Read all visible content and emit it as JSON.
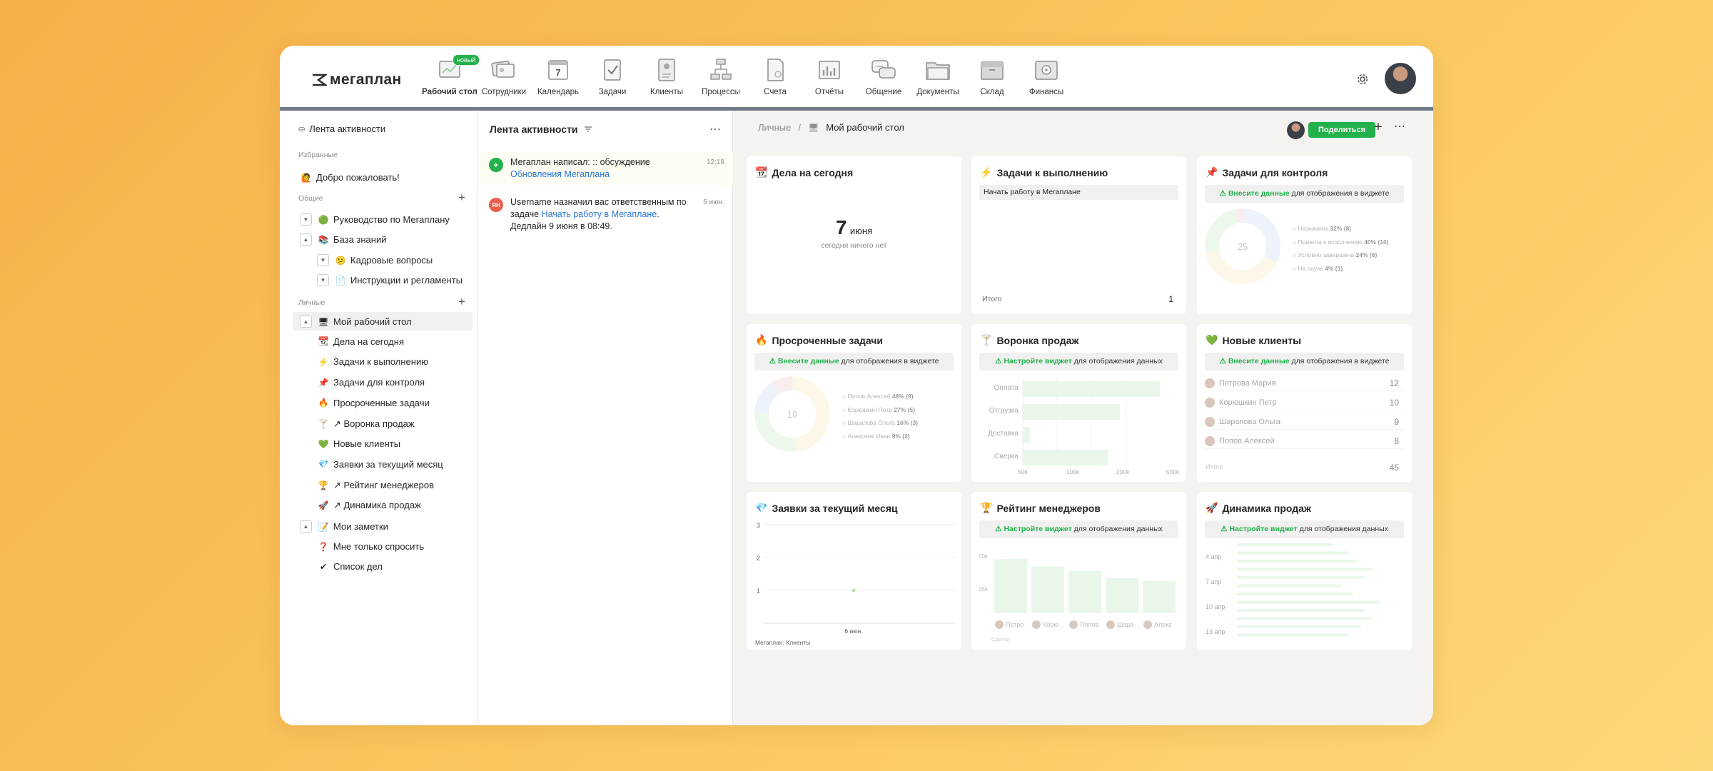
{
  "app": {
    "logo_text": "мегаплан"
  },
  "nav": [
    {
      "label": "Рабочий стол",
      "icon": "desktop-icon",
      "badge": "новый",
      "active": true
    },
    {
      "label": "Сотрудники",
      "icon": "employees-icon"
    },
    {
      "label": "Календарь",
      "icon": "calendar-icon",
      "day": "7"
    },
    {
      "label": "Задачи",
      "icon": "tasks-icon"
    },
    {
      "label": "Клиенты",
      "icon": "clients-icon"
    },
    {
      "label": "Процессы",
      "icon": "processes-icon"
    },
    {
      "label": "Счета",
      "icon": "invoices-icon"
    },
    {
      "label": "Отчёты",
      "icon": "reports-icon"
    },
    {
      "label": "Общение",
      "icon": "chat-icon"
    },
    {
      "label": "Документы",
      "icon": "documents-icon"
    },
    {
      "label": "Склад",
      "icon": "warehouse-icon"
    },
    {
      "label": "Финансы",
      "icon": "finance-icon"
    }
  ],
  "sidebar": {
    "top_item": "Лента активности",
    "favorites_title": "Избранные",
    "favorites": [
      {
        "label": "Добро пожаловать!",
        "emoji": "🙋"
      }
    ],
    "common_title": "Общие",
    "common": [
      {
        "label": "Руководство по Мегаплану",
        "emoji": "🟢"
      },
      {
        "label": "База знаний",
        "emoji": "📚"
      },
      {
        "label": "Кадровые вопросы",
        "emoji": "😕"
      },
      {
        "label": "Инструкции и регламенты",
        "emoji": "📄"
      }
    ],
    "personal_title": "Личные",
    "personal": [
      {
        "label": "Мой рабочий стол",
        "emoji": "🖥"
      },
      {
        "label": "Дела на сегодня",
        "emoji": "📆"
      },
      {
        "label": "Задачи к выполнению",
        "emoji": "⚡"
      },
      {
        "label": "Задачи для контроля",
        "emoji": "📌"
      },
      {
        "label": "Просроченные задачи",
        "emoji": "🔥"
      },
      {
        "label": "↗ Воронка продаж",
        "emoji": "🍸"
      },
      {
        "label": "Новые клиенты",
        "emoji": "💚"
      },
      {
        "label": "Заявки за текущий месяц",
        "emoji": "💎"
      },
      {
        "label": "↗ Рейтинг менеджеров",
        "emoji": "🏆"
      },
      {
        "label": "↗ Динамика продаж",
        "emoji": "🚀"
      },
      {
        "label": "Мои заметки",
        "emoji": "📝"
      },
      {
        "label": "Мне только спросить",
        "emoji": "❓"
      },
      {
        "label": "Список дел",
        "emoji": "✔"
      }
    ]
  },
  "feed": {
    "title": "Лента активности",
    "items": [
      {
        "prefix": "Мегаплан написал: :: обсуждение",
        "link": "Обновления Мегаплана",
        "suffix": "",
        "time": "12:18",
        "avatar": ""
      },
      {
        "prefix": "Username назначил вас ответственным по задаче ",
        "link": "Начать работу в Мегаплане",
        "suffix": ". Дедлайн 9 июня в 08:49.",
        "time": "6 июн.",
        "avatar": "ЯН"
      }
    ]
  },
  "main": {
    "breadcrumb_root": "Личные",
    "breadcrumb_current": "Мой рабочий стол",
    "share_label": "Поделиться"
  },
  "widgets": {
    "today": {
      "title": "Дела на сегодня",
      "emoji": "📆",
      "day": "7",
      "month": "июня",
      "note": "сегодня ничего нет"
    },
    "todo": {
      "title": "Задачи к выполнению",
      "emoji": "⚡",
      "task": "Начать работу в Мегаплане",
      "total_label": "Итого",
      "total": "1"
    },
    "control": {
      "title": "Задачи для контроля",
      "emoji": "📌",
      "warn_link": "⚠ Внесите данные",
      "warn_text": " для отображения в виджете",
      "center": "25",
      "legend": [
        {
          "label": "Назначена",
          "value": "32% (8)"
        },
        {
          "label": "Принята к исполнению",
          "value": "40% (10)"
        },
        {
          "label": "Условно завершена",
          "value": "24% (6)"
        },
        {
          "label": "На паузе",
          "value": "4% (1)"
        }
      ]
    },
    "overdue": {
      "title": "Просроченные задачи",
      "emoji": "🔥",
      "warn_link": "⚠ Внесите данные",
      "warn_text": " для отображения в виджете",
      "center": "19",
      "legend": [
        {
          "label": "Попов Алексей",
          "value": "48% (9)"
        },
        {
          "label": "Корюшкин Петр",
          "value": "27% (5)"
        },
        {
          "label": "Шарапова Ольга",
          "value": "16% (3)"
        },
        {
          "label": "Алексеев Иван",
          "value": "9% (2)"
        }
      ]
    },
    "funnel": {
      "title": "Воронка продаж",
      "emoji": "🍸",
      "warn_link": "⚠ Настройте виджет",
      "warn_text": " для отображения данных",
      "stages": [
        {
          "label": "Оплата",
          "value": 480
        },
        {
          "label": "Отгрузка",
          "value": 340
        },
        {
          "label": "Доставка",
          "value": 25
        },
        {
          "label": "Сверка",
          "value": 300
        }
      ],
      "ticks": [
        "50k",
        "100k",
        "200k",
        "500k"
      ]
    },
    "clients": {
      "title": "Новые клиенты",
      "emoji": "💚",
      "warn_link": "⚠ Внесите данные",
      "warn_text": " для отображения в виджете",
      "rows": [
        {
          "name": "Петрова Мария",
          "value": "12"
        },
        {
          "name": "Корюшкин Петр",
          "value": "10"
        },
        {
          "name": "Шарапова Ольга",
          "value": "9"
        },
        {
          "name": "Попов Алексей",
          "value": "8"
        }
      ],
      "total_label": "Итого",
      "total": "45"
    },
    "requests": {
      "title": "Заявки за текущий месяц",
      "emoji": "💎",
      "yticks": [
        "3",
        "2",
        "1"
      ],
      "xlabel": "6 июн.",
      "legend": "Мегаплан: Клиенты"
    },
    "rating": {
      "title": "Рейтинг менеджеров",
      "emoji": "🏆",
      "warn_link": "⚠ Настройте виджет",
      "warn_text": " для отображения данных",
      "yticks": [
        "50k",
        "25k"
      ],
      "names": [
        "Петро",
        "Корю",
        "Попов",
        "Шара",
        "Алекс"
      ],
      "values": [
        37,
        32,
        29,
        24,
        22
      ],
      "legend": "Сделки"
    },
    "dynamics": {
      "title": "Динамика продаж",
      "emoji": "🚀",
      "warn_link": "⚠ Настройте виджет",
      "warn_text": " для отображения данных",
      "dates": [
        "4 апр",
        "7 апр",
        "10 апр",
        "13 апр"
      ]
    }
  },
  "colors": {
    "accent": "#22b14c",
    "link": "#2b77d6",
    "topline": "#707c87"
  }
}
